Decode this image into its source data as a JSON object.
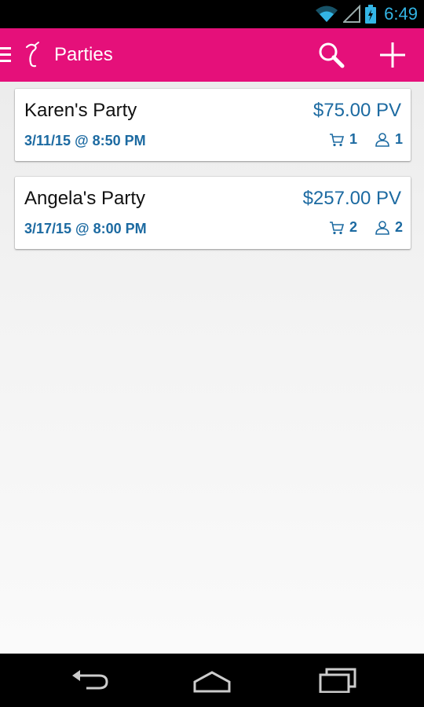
{
  "status_bar": {
    "time": "6:49",
    "icons": [
      "wifi-icon",
      "signal-icon",
      "battery-charging-icon"
    ]
  },
  "app_bar": {
    "title": "Parties",
    "icons": [
      "menu-icon",
      "logo-icon",
      "search-icon",
      "add-icon"
    ],
    "background_color": "#e5107a"
  },
  "parties": [
    {
      "name": "Karen's Party",
      "pv": "$75.00 PV",
      "datetime": "3/11/15 @ 8:50 PM",
      "orders": "1",
      "guests": "1"
    },
    {
      "name": "Angela's Party",
      "pv": "$257.00 PV",
      "datetime": "3/17/15 @ 8:00 PM",
      "orders": "2",
      "guests": "2"
    }
  ],
  "colors": {
    "accent_text": "#1c6aa1",
    "status_icons": "#33b5e5"
  },
  "nav_bar": {
    "icons": [
      "back-icon",
      "home-icon",
      "recents-icon"
    ]
  }
}
